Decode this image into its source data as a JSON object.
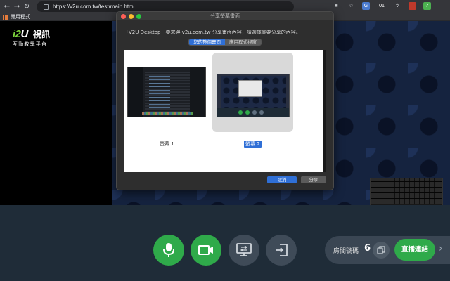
{
  "browser": {
    "url": "https://v2u.com.tw/test/main.html",
    "bookmark_apps_label": "應用程式",
    "ext_badge": "01"
  },
  "logo": {
    "text_part1": "i2",
    "text_part2": "U",
    "cn_title": "視訊",
    "subtitle": "互動教學平台"
  },
  "dialog": {
    "title": "分享螢幕畫面",
    "prompt": "「V2U Desktop」要求與 v2u.com.tw 分享畫面內容，請選擇你要分享的內容。",
    "tabs": [
      {
        "label": "您的整個畫面",
        "active": true
      },
      {
        "label": "應用程式視窗",
        "active": false
      }
    ],
    "screens": [
      {
        "label": "螢幕 1",
        "selected": false
      },
      {
        "label": "螢幕 2",
        "selected": true
      }
    ],
    "cancel_label": "取消",
    "share_label": "分享"
  },
  "toolbar": {
    "room_label": "房間號碼",
    "room_number_partial": "6(",
    "live_label": "直播連結"
  },
  "colors": {
    "accent_green": "#2faa4a",
    "accent_blue": "#2f6fd6",
    "bar_bg": "#1f2c38"
  }
}
